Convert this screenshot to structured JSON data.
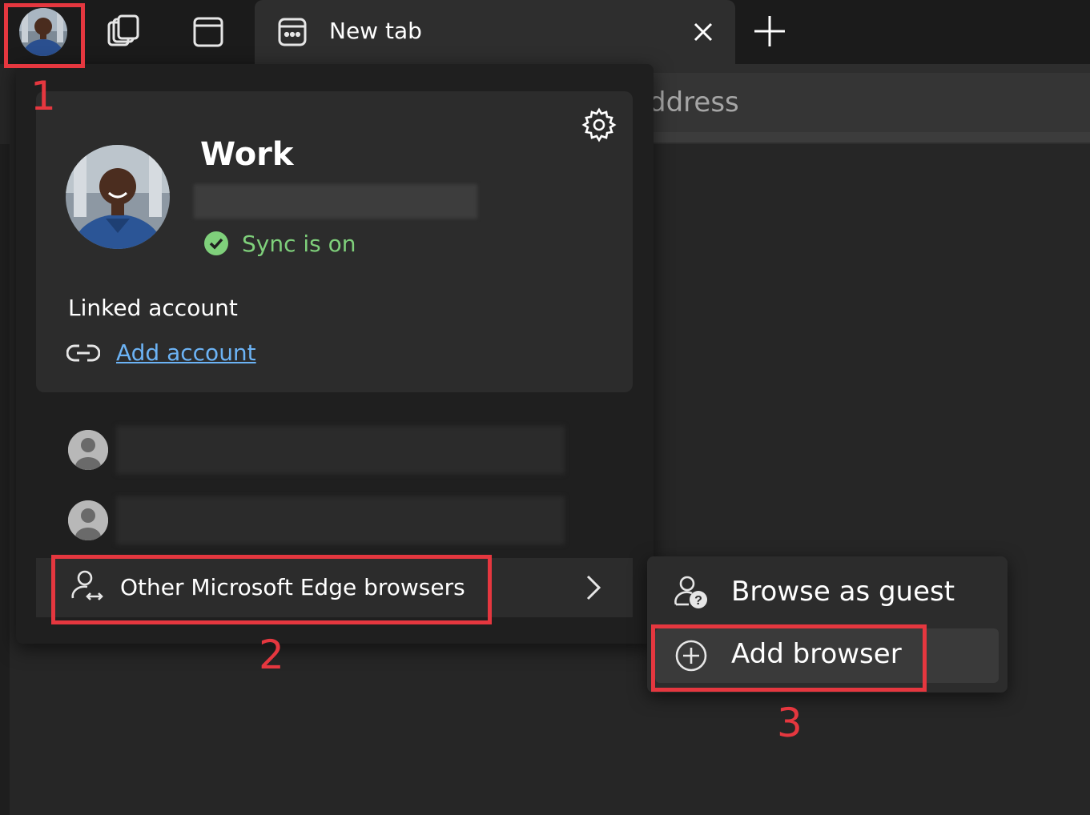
{
  "tabstrip": {
    "profile_icon": "profile-avatar",
    "workspaces_icon": "workspaces-icon",
    "vertical_tabs_icon": "vertical-tabs-icon",
    "active_tab": {
      "title": "New tab",
      "icon": "new-tab-page-icon",
      "close_icon": "close-icon"
    },
    "new_tab_icon": "plus-icon"
  },
  "toolbar": {
    "address_placeholder": "ddress"
  },
  "profile_flyout": {
    "settings_icon": "gear-icon",
    "profile_name": "Work",
    "sync_status": "Sync is on",
    "linked_account_label": "Linked account",
    "add_account_link": "Add account",
    "other_accounts": [
      {
        "avatar": "default-person-avatar"
      },
      {
        "avatar": "default-person-avatar"
      }
    ],
    "other_browsers_label": "Other Microsoft Edge browsers"
  },
  "submenu": {
    "browse_as_guest": "Browse as guest",
    "add_browser": "Add browser"
  },
  "callouts": [
    "1",
    "2",
    "3"
  ],
  "colors": {
    "callout": "#e5373f",
    "sync": "#7fd07b",
    "link": "#6cb3f5"
  }
}
